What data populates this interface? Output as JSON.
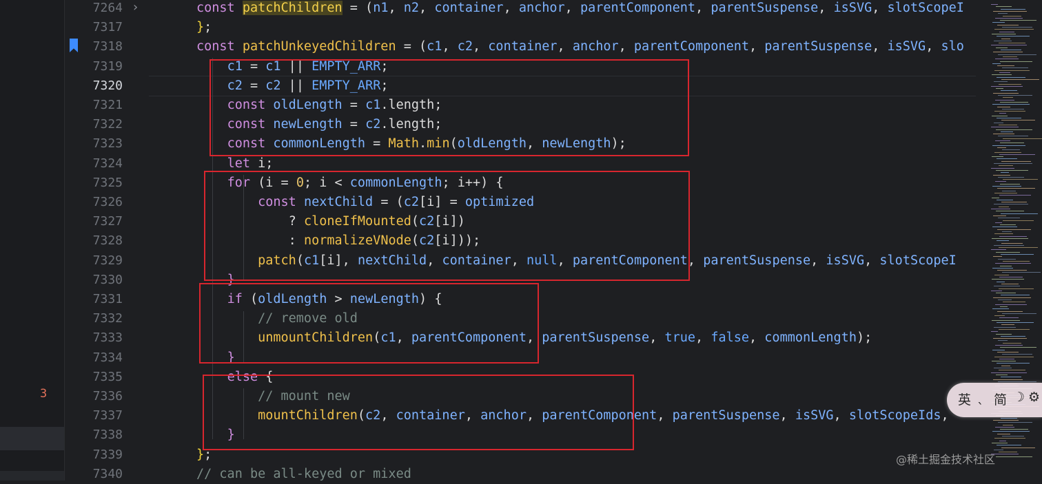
{
  "gutter": {
    "line_numbers": [
      "7264",
      "7317",
      "7318",
      "7319",
      "7320",
      "7321",
      "7322",
      "7323",
      "7324",
      "7325",
      "7326",
      "7327",
      "7328",
      "7329",
      "7330",
      "7331",
      "7332",
      "7333",
      "7334",
      "7335",
      "7336",
      "7337",
      "7338",
      "7339",
      "7340"
    ],
    "current_line": "7320"
  },
  "left_panel": {
    "badge_count": "3"
  },
  "code_lines": [
    [
      [
        "k",
        "const "
      ],
      [
        "hl",
        "patchChildren"
      ],
      [
        "o",
        " = ("
      ],
      [
        "v",
        "n1"
      ],
      [
        "o",
        ", "
      ],
      [
        "v",
        "n2"
      ],
      [
        "o",
        ", "
      ],
      [
        "v",
        "container"
      ],
      [
        "o",
        ", "
      ],
      [
        "v",
        "anchor"
      ],
      [
        "o",
        ", "
      ],
      [
        "v",
        "parentComponent"
      ],
      [
        "o",
        ", "
      ],
      [
        "v",
        "parentSuspense"
      ],
      [
        "o",
        ", "
      ],
      [
        "v",
        "isSVG"
      ],
      [
        "o",
        ", "
      ],
      [
        "v",
        "slotScopeI"
      ]
    ],
    [
      [
        "gold",
        "}"
      ],
      [
        "o",
        ";"
      ]
    ],
    [
      [
        "k",
        "const "
      ],
      [
        "f",
        "patchUnkeyedChildren"
      ],
      [
        "o",
        " = ("
      ],
      [
        "v",
        "c1"
      ],
      [
        "o",
        ", "
      ],
      [
        "v",
        "c2"
      ],
      [
        "o",
        ", "
      ],
      [
        "v",
        "container"
      ],
      [
        "o",
        ", "
      ],
      [
        "v",
        "anchor"
      ],
      [
        "o",
        ", "
      ],
      [
        "v",
        "parentComponent"
      ],
      [
        "o",
        ", "
      ],
      [
        "v",
        "parentSuspense"
      ],
      [
        "o",
        ", "
      ],
      [
        "v",
        "isSVG"
      ],
      [
        "o",
        ", "
      ],
      [
        "v",
        "slo"
      ]
    ],
    [
      [
        "o",
        "    "
      ],
      [
        "v",
        "c1"
      ],
      [
        "o",
        " = "
      ],
      [
        "v",
        "c1"
      ],
      [
        "o",
        " || "
      ],
      [
        "b",
        "EMPTY_ARR"
      ],
      [
        "o",
        ";"
      ]
    ],
    [
      [
        "o",
        "    "
      ],
      [
        "v",
        "c2"
      ],
      [
        "o",
        " = "
      ],
      [
        "v",
        "c2"
      ],
      [
        "o",
        " || "
      ],
      [
        "b",
        "EMPTY_ARR"
      ],
      [
        "o",
        ";"
      ]
    ],
    [
      [
        "o",
        "    "
      ],
      [
        "k",
        "const "
      ],
      [
        "v",
        "oldLength"
      ],
      [
        "o",
        " = "
      ],
      [
        "v",
        "c1"
      ],
      [
        "o",
        "."
      ],
      [
        "o",
        "length;"
      ]
    ],
    [
      [
        "o",
        "    "
      ],
      [
        "k",
        "const "
      ],
      [
        "v",
        "newLength"
      ],
      [
        "o",
        " = "
      ],
      [
        "v",
        "c2"
      ],
      [
        "o",
        "."
      ],
      [
        "o",
        "length;"
      ]
    ],
    [
      [
        "o",
        "    "
      ],
      [
        "k",
        "const "
      ],
      [
        "v",
        "commonLength"
      ],
      [
        "o",
        " = "
      ],
      [
        "f",
        "Math"
      ],
      [
        "o",
        "."
      ],
      [
        "f",
        "min"
      ],
      [
        "o",
        "("
      ],
      [
        "v",
        "oldLength"
      ],
      [
        "o",
        ", "
      ],
      [
        "v",
        "newLength"
      ],
      [
        "o",
        ");"
      ]
    ],
    [
      [
        "o",
        "    "
      ],
      [
        "k",
        "let "
      ],
      [
        "o",
        "i;"
      ]
    ],
    [
      [
        "o",
        "    "
      ],
      [
        "k",
        "for "
      ],
      [
        "o",
        "(i = "
      ],
      [
        "n",
        "0"
      ],
      [
        "o",
        "; i < "
      ],
      [
        "v",
        "commonLength"
      ],
      [
        "o",
        "; i++) {"
      ]
    ],
    [
      [
        "o",
        "        "
      ],
      [
        "k",
        "const "
      ],
      [
        "v",
        "nextChild"
      ],
      [
        "o",
        " = ("
      ],
      [
        "v",
        "c2"
      ],
      [
        "o",
        "[i] = "
      ],
      [
        "v",
        "optimized"
      ]
    ],
    [
      [
        "o",
        "            ? "
      ],
      [
        "f",
        "cloneIfMounted"
      ],
      [
        "o",
        "("
      ],
      [
        "v",
        "c2"
      ],
      [
        "o",
        "[i])"
      ]
    ],
    [
      [
        "o",
        "            : "
      ],
      [
        "f",
        "normalizeVNode"
      ],
      [
        "o",
        "("
      ],
      [
        "v",
        "c2"
      ],
      [
        "o",
        "[i]));"
      ]
    ],
    [
      [
        "o",
        "        "
      ],
      [
        "f",
        "patch"
      ],
      [
        "o",
        "("
      ],
      [
        "v",
        "c1"
      ],
      [
        "o",
        "[i], "
      ],
      [
        "v",
        "nextChild"
      ],
      [
        "o",
        ", "
      ],
      [
        "v",
        "container"
      ],
      [
        "o",
        ", "
      ],
      [
        "b",
        "null"
      ],
      [
        "o",
        ", "
      ],
      [
        "v",
        "parentComponent"
      ],
      [
        "o",
        ", "
      ],
      [
        "v",
        "parentSuspense"
      ],
      [
        "o",
        ", "
      ],
      [
        "v",
        "isSVG"
      ],
      [
        "o",
        ", "
      ],
      [
        "v",
        "slotScopeI"
      ]
    ],
    [
      [
        "o",
        "    "
      ],
      [
        "k",
        "}"
      ]
    ],
    [
      [
        "o",
        "    "
      ],
      [
        "k",
        "if "
      ],
      [
        "o",
        "("
      ],
      [
        "v",
        "oldLength"
      ],
      [
        "o",
        " > "
      ],
      [
        "v",
        "newLength"
      ],
      [
        "o",
        ") {"
      ]
    ],
    [
      [
        "o",
        "        "
      ],
      [
        "c",
        "// remove old"
      ]
    ],
    [
      [
        "o",
        "        "
      ],
      [
        "f",
        "unmountChildren"
      ],
      [
        "o",
        "("
      ],
      [
        "v",
        "c1"
      ],
      [
        "o",
        ", "
      ],
      [
        "v",
        "parentComponent"
      ],
      [
        "o",
        ", "
      ],
      [
        "v",
        "parentSuspense"
      ],
      [
        "o",
        ", "
      ],
      [
        "b",
        "true"
      ],
      [
        "o",
        ", "
      ],
      [
        "b",
        "false"
      ],
      [
        "o",
        ", "
      ],
      [
        "v",
        "commonLength"
      ],
      [
        "o",
        ");"
      ]
    ],
    [
      [
        "o",
        "    "
      ],
      [
        "k",
        "}"
      ]
    ],
    [
      [
        "o",
        "    "
      ],
      [
        "k",
        "else "
      ],
      [
        "o",
        "{"
      ]
    ],
    [
      [
        "o",
        "        "
      ],
      [
        "c",
        "// mount new"
      ]
    ],
    [
      [
        "o",
        "        "
      ],
      [
        "f",
        "mountChildren"
      ],
      [
        "o",
        "("
      ],
      [
        "v",
        "c2"
      ],
      [
        "o",
        ", "
      ],
      [
        "v",
        "container"
      ],
      [
        "o",
        ", "
      ],
      [
        "v",
        "anchor"
      ],
      [
        "o",
        ", "
      ],
      [
        "v",
        "parentComponent"
      ],
      [
        "o",
        ", "
      ],
      [
        "v",
        "parentSuspense"
      ],
      [
        "o",
        ", "
      ],
      [
        "v",
        "isSVG"
      ],
      [
        "o",
        ", "
      ],
      [
        "v",
        "slotScopeIds"
      ],
      [
        "o",
        ","
      ]
    ],
    [
      [
        "o",
        "    "
      ],
      [
        "k",
        "}"
      ]
    ],
    [
      [
        "gold",
        "}"
      ],
      [
        "o",
        ";"
      ]
    ],
    [
      [
        "c",
        "// can be all-keyed or mixed"
      ]
    ]
  ],
  "ime": {
    "lang": "英",
    "punct": "ˎ",
    "mode": "简",
    "moon": "☽",
    "gear": "⚙"
  },
  "watermark": "@稀土掘金技术社区"
}
